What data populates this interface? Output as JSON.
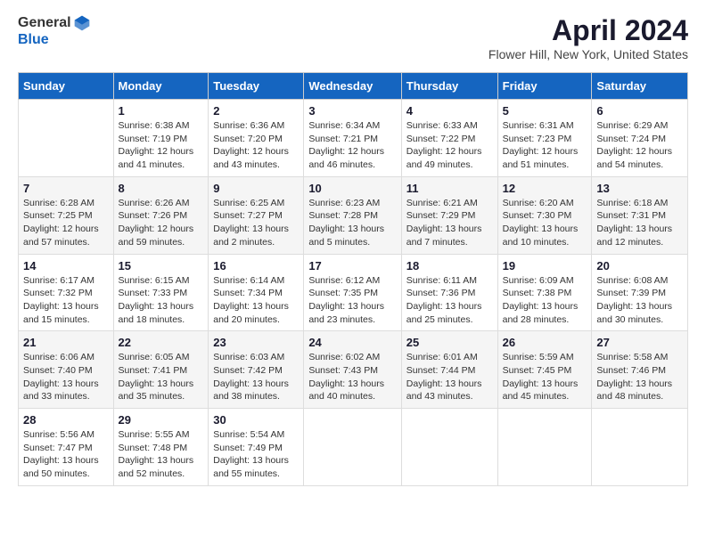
{
  "header": {
    "logo": {
      "general": "General",
      "blue": "Blue"
    },
    "title": "April 2024",
    "location": "Flower Hill, New York, United States"
  },
  "weekdays": [
    "Sunday",
    "Monday",
    "Tuesday",
    "Wednesday",
    "Thursday",
    "Friday",
    "Saturday"
  ],
  "weeks": [
    [
      {
        "day": "",
        "sunrise": "",
        "sunset": "",
        "daylight": ""
      },
      {
        "day": "1",
        "sunrise": "Sunrise: 6:38 AM",
        "sunset": "Sunset: 7:19 PM",
        "daylight": "Daylight: 12 hours and 41 minutes."
      },
      {
        "day": "2",
        "sunrise": "Sunrise: 6:36 AM",
        "sunset": "Sunset: 7:20 PM",
        "daylight": "Daylight: 12 hours and 43 minutes."
      },
      {
        "day": "3",
        "sunrise": "Sunrise: 6:34 AM",
        "sunset": "Sunset: 7:21 PM",
        "daylight": "Daylight: 12 hours and 46 minutes."
      },
      {
        "day": "4",
        "sunrise": "Sunrise: 6:33 AM",
        "sunset": "Sunset: 7:22 PM",
        "daylight": "Daylight: 12 hours and 49 minutes."
      },
      {
        "day": "5",
        "sunrise": "Sunrise: 6:31 AM",
        "sunset": "Sunset: 7:23 PM",
        "daylight": "Daylight: 12 hours and 51 minutes."
      },
      {
        "day": "6",
        "sunrise": "Sunrise: 6:29 AM",
        "sunset": "Sunset: 7:24 PM",
        "daylight": "Daylight: 12 hours and 54 minutes."
      }
    ],
    [
      {
        "day": "7",
        "sunrise": "Sunrise: 6:28 AM",
        "sunset": "Sunset: 7:25 PM",
        "daylight": "Daylight: 12 hours and 57 minutes."
      },
      {
        "day": "8",
        "sunrise": "Sunrise: 6:26 AM",
        "sunset": "Sunset: 7:26 PM",
        "daylight": "Daylight: 12 hours and 59 minutes."
      },
      {
        "day": "9",
        "sunrise": "Sunrise: 6:25 AM",
        "sunset": "Sunset: 7:27 PM",
        "daylight": "Daylight: 13 hours and 2 minutes."
      },
      {
        "day": "10",
        "sunrise": "Sunrise: 6:23 AM",
        "sunset": "Sunset: 7:28 PM",
        "daylight": "Daylight: 13 hours and 5 minutes."
      },
      {
        "day": "11",
        "sunrise": "Sunrise: 6:21 AM",
        "sunset": "Sunset: 7:29 PM",
        "daylight": "Daylight: 13 hours and 7 minutes."
      },
      {
        "day": "12",
        "sunrise": "Sunrise: 6:20 AM",
        "sunset": "Sunset: 7:30 PM",
        "daylight": "Daylight: 13 hours and 10 minutes."
      },
      {
        "day": "13",
        "sunrise": "Sunrise: 6:18 AM",
        "sunset": "Sunset: 7:31 PM",
        "daylight": "Daylight: 13 hours and 12 minutes."
      }
    ],
    [
      {
        "day": "14",
        "sunrise": "Sunrise: 6:17 AM",
        "sunset": "Sunset: 7:32 PM",
        "daylight": "Daylight: 13 hours and 15 minutes."
      },
      {
        "day": "15",
        "sunrise": "Sunrise: 6:15 AM",
        "sunset": "Sunset: 7:33 PM",
        "daylight": "Daylight: 13 hours and 18 minutes."
      },
      {
        "day": "16",
        "sunrise": "Sunrise: 6:14 AM",
        "sunset": "Sunset: 7:34 PM",
        "daylight": "Daylight: 13 hours and 20 minutes."
      },
      {
        "day": "17",
        "sunrise": "Sunrise: 6:12 AM",
        "sunset": "Sunset: 7:35 PM",
        "daylight": "Daylight: 13 hours and 23 minutes."
      },
      {
        "day": "18",
        "sunrise": "Sunrise: 6:11 AM",
        "sunset": "Sunset: 7:36 PM",
        "daylight": "Daylight: 13 hours and 25 minutes."
      },
      {
        "day": "19",
        "sunrise": "Sunrise: 6:09 AM",
        "sunset": "Sunset: 7:38 PM",
        "daylight": "Daylight: 13 hours and 28 minutes."
      },
      {
        "day": "20",
        "sunrise": "Sunrise: 6:08 AM",
        "sunset": "Sunset: 7:39 PM",
        "daylight": "Daylight: 13 hours and 30 minutes."
      }
    ],
    [
      {
        "day": "21",
        "sunrise": "Sunrise: 6:06 AM",
        "sunset": "Sunset: 7:40 PM",
        "daylight": "Daylight: 13 hours and 33 minutes."
      },
      {
        "day": "22",
        "sunrise": "Sunrise: 6:05 AM",
        "sunset": "Sunset: 7:41 PM",
        "daylight": "Daylight: 13 hours and 35 minutes."
      },
      {
        "day": "23",
        "sunrise": "Sunrise: 6:03 AM",
        "sunset": "Sunset: 7:42 PM",
        "daylight": "Daylight: 13 hours and 38 minutes."
      },
      {
        "day": "24",
        "sunrise": "Sunrise: 6:02 AM",
        "sunset": "Sunset: 7:43 PM",
        "daylight": "Daylight: 13 hours and 40 minutes."
      },
      {
        "day": "25",
        "sunrise": "Sunrise: 6:01 AM",
        "sunset": "Sunset: 7:44 PM",
        "daylight": "Daylight: 13 hours and 43 minutes."
      },
      {
        "day": "26",
        "sunrise": "Sunrise: 5:59 AM",
        "sunset": "Sunset: 7:45 PM",
        "daylight": "Daylight: 13 hours and 45 minutes."
      },
      {
        "day": "27",
        "sunrise": "Sunrise: 5:58 AM",
        "sunset": "Sunset: 7:46 PM",
        "daylight": "Daylight: 13 hours and 48 minutes."
      }
    ],
    [
      {
        "day": "28",
        "sunrise": "Sunrise: 5:56 AM",
        "sunset": "Sunset: 7:47 PM",
        "daylight": "Daylight: 13 hours and 50 minutes."
      },
      {
        "day": "29",
        "sunrise": "Sunrise: 5:55 AM",
        "sunset": "Sunset: 7:48 PM",
        "daylight": "Daylight: 13 hours and 52 minutes."
      },
      {
        "day": "30",
        "sunrise": "Sunrise: 5:54 AM",
        "sunset": "Sunset: 7:49 PM",
        "daylight": "Daylight: 13 hours and 55 minutes."
      },
      {
        "day": "",
        "sunrise": "",
        "sunset": "",
        "daylight": ""
      },
      {
        "day": "",
        "sunrise": "",
        "sunset": "",
        "daylight": ""
      },
      {
        "day": "",
        "sunrise": "",
        "sunset": "",
        "daylight": ""
      },
      {
        "day": "",
        "sunrise": "",
        "sunset": "",
        "daylight": ""
      }
    ]
  ]
}
